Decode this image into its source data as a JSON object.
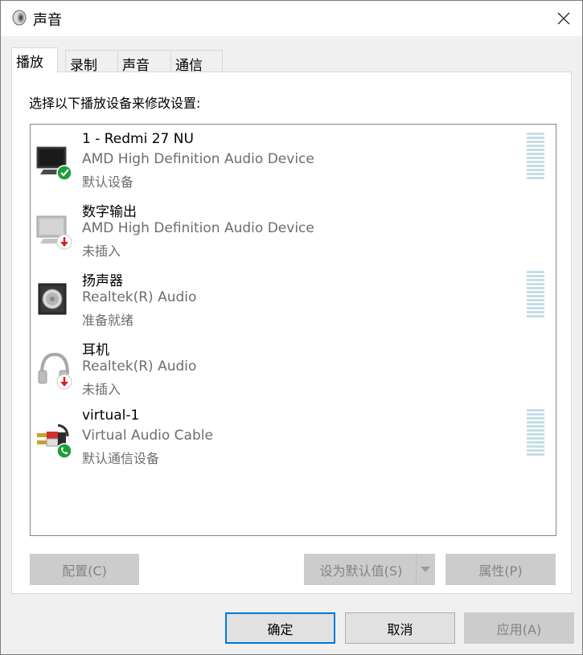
{
  "window": {
    "title": "声音"
  },
  "tabs": [
    {
      "label": "播放",
      "active": true
    },
    {
      "label": "录制",
      "active": false
    },
    {
      "label": "声音",
      "active": false
    },
    {
      "label": "通信",
      "active": false
    }
  ],
  "panel": {
    "instruction": "选择以下播放设备来修改设置:",
    "devices": [
      {
        "name": "1 - Redmi 27 NU",
        "description": "AMD High Definition Audio Device",
        "status": "默认设备",
        "icon": "monitor-icon",
        "badge": "default-check-badge-icon",
        "badge_color": "#1e9e3a"
      },
      {
        "name": "数字输出",
        "description": "AMD High Definition Audio Device",
        "status": "未插入",
        "icon": "monitor-icon",
        "badge": "unplugged-arrow-badge-icon",
        "badge_color": "#d3202a"
      },
      {
        "name": "扬声器",
        "description": "Realtek(R) Audio",
        "status": "准备就绪",
        "icon": "speaker-icon"
      },
      {
        "name": "耳机",
        "description": "Realtek(R) Audio",
        "status": "未插入",
        "icon": "headphones-icon",
        "badge": "unplugged-arrow-badge-icon",
        "badge_color": "#d3202a"
      },
      {
        "name": "virtual-1",
        "description": "Virtual Audio Cable",
        "status": "默认通信设备",
        "icon": "audio-cable-icon",
        "badge": "communication-phone-badge-icon",
        "badge_color": "#1e9e3a"
      }
    ],
    "buttons": {
      "configure": "配置(C)",
      "set_default": "设为默认值(S)",
      "properties": "属性(P)"
    }
  },
  "footer": {
    "ok": "确定",
    "cancel": "取消",
    "apply": "应用(A)"
  },
  "colors": {
    "accent": "#0078d7",
    "meter": "#c5dde8"
  }
}
